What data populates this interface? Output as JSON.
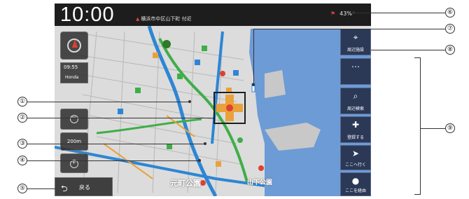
{
  "status_bar": {
    "time": "10:00",
    "signal": "",
    "location": "横浜市中区山下町 付近",
    "battery_text": "43%"
  },
  "left_panel": {
    "gps_time": "09:55",
    "gps_label": "Honda",
    "zoom_out_symbol": "−",
    "scale_label": "200m",
    "zoom_in_symbol": "+"
  },
  "back_button": {
    "icon": "back-arrow-icon",
    "label": "戻る"
  },
  "right_menu": [
    {
      "icon": "destination-icon",
      "label": "周辺施設"
    },
    {
      "icon": "route-icon",
      "label": ""
    },
    {
      "icon": "search-icon",
      "label": "周辺検索"
    },
    {
      "icon": "register-pin-icon",
      "label": "登録する"
    },
    {
      "icon": "go-here-icon",
      "label": "ここへ行く"
    },
    {
      "icon": "waypoint-icon",
      "label": "ここを経由"
    }
  ],
  "map_labels": [
    {
      "text": "元町公園"
    },
    {
      "text": "山下公園"
    }
  ],
  "callouts": [
    "①",
    "②",
    "③",
    "④",
    "⑤",
    "⑥",
    "⑦",
    "⑧",
    "⑨"
  ],
  "colors": {
    "water": "#6d9bd6",
    "land": "#dcdcdc",
    "main_road": "#2d86d4",
    "route": "#3fae49",
    "menu_bg": "#2b3957"
  }
}
